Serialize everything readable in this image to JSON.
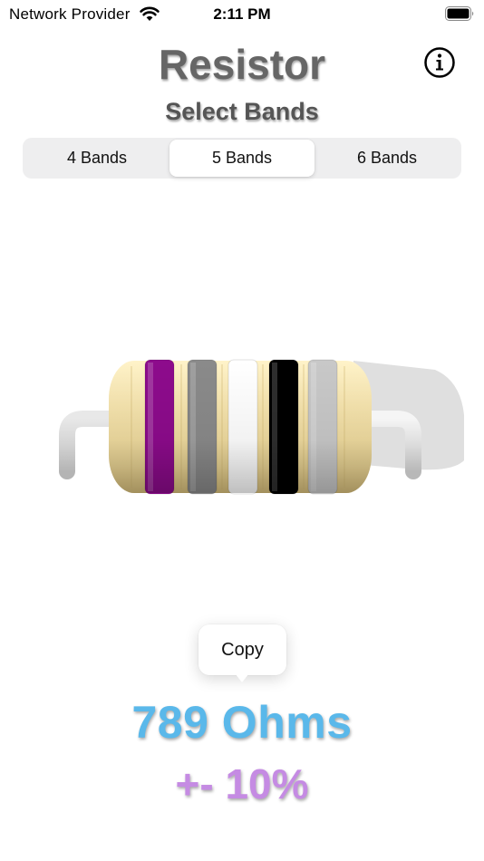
{
  "status_bar": {
    "carrier": "Network Provider",
    "time": "2:11 PM",
    "wifi_icon": "wifi-icon",
    "battery_icon": "battery-icon"
  },
  "header": {
    "title": "Resistor",
    "info_icon": "info-icon"
  },
  "band_selector": {
    "label": "Select Bands",
    "segments": [
      {
        "label": "4 Bands",
        "selected": false
      },
      {
        "label": "5 Bands",
        "selected": true
      },
      {
        "label": "6 Bands",
        "selected": false
      }
    ]
  },
  "resistor": {
    "body_color": "#f2dfa6",
    "lead_color": "#d9d9d9",
    "bands": [
      {
        "name": "violet",
        "color": "#8d0b8c"
      },
      {
        "name": "gray",
        "color": "#8a8a8a"
      },
      {
        "name": "white",
        "color": "#ffffff"
      },
      {
        "name": "black",
        "color": "#000000"
      },
      {
        "name": "silver",
        "color": "#c8c8c8"
      }
    ]
  },
  "menu": {
    "copy_label": "Copy"
  },
  "result": {
    "resistance": "789 Ohms",
    "tolerance": "+- 10%",
    "resistance_color": "#5ab8ea",
    "tolerance_color": "#c58be3"
  }
}
